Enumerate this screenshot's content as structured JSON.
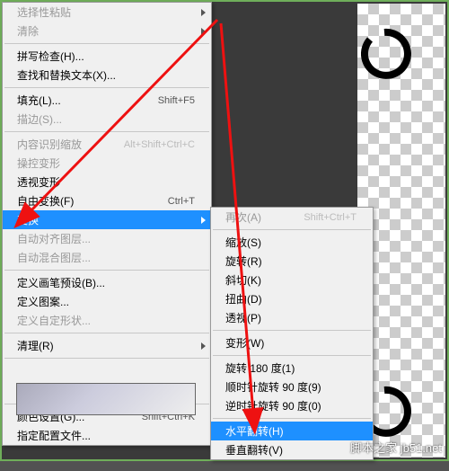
{
  "main_menu": {
    "groups": [
      [
        {
          "label": "选择性粘贴",
          "shortcut": "",
          "disabled": true,
          "arrow": true
        },
        {
          "label": "清除",
          "shortcut": "",
          "disabled": true,
          "arrow": true
        }
      ],
      [
        {
          "label": "拼写检查(H)...",
          "shortcut": ""
        },
        {
          "label": "查找和替换文本(X)...",
          "shortcut": ""
        }
      ],
      [
        {
          "label": "填充(L)...",
          "shortcut": "Shift+F5"
        },
        {
          "label": "描边(S)...",
          "shortcut": "",
          "disabled": true
        }
      ],
      [
        {
          "label": "内容识别缩放",
          "shortcut": "Alt+Shift+Ctrl+C",
          "disabled": true
        },
        {
          "label": "操控变形",
          "shortcut": "",
          "disabled": true
        },
        {
          "label": "透视变形",
          "shortcut": ""
        },
        {
          "label": "自由变换(F)",
          "shortcut": "Ctrl+T"
        },
        {
          "label": "变换",
          "shortcut": "",
          "highlight": true,
          "arrow": true
        },
        {
          "label": "自动对齐图层...",
          "shortcut": "",
          "disabled": true
        },
        {
          "label": "自动混合图层...",
          "shortcut": "",
          "disabled": true
        }
      ],
      [
        {
          "label": "定义画笔预设(B)...",
          "shortcut": ""
        },
        {
          "label": "定义图案...",
          "shortcut": ""
        },
        {
          "label": "定义自定形状...",
          "shortcut": "",
          "disabled": true
        }
      ],
      [
        {
          "label": "清理(R)",
          "shortcut": "",
          "arrow": true
        }
      ]
    ],
    "bottom": [
      {
        "label": "颜色设置(G)...",
        "shortcut": "Shift+Ctrl+K"
      },
      {
        "label": "指定配置文件...",
        "shortcut": ""
      }
    ]
  },
  "sub_menu": {
    "groups": [
      [
        {
          "label": "再次(A)",
          "shortcut": "Shift+Ctrl+T",
          "disabled": true
        }
      ],
      [
        {
          "label": "缩放(S)",
          "shortcut": ""
        },
        {
          "label": "旋转(R)",
          "shortcut": ""
        },
        {
          "label": "斜切(K)",
          "shortcut": ""
        },
        {
          "label": "扭曲(D)",
          "shortcut": ""
        },
        {
          "label": "透视(P)",
          "shortcut": ""
        }
      ],
      [
        {
          "label": "变形(W)",
          "shortcut": ""
        }
      ],
      [
        {
          "label": "旋转 180 度(1)",
          "shortcut": ""
        },
        {
          "label": "顺时针旋转 90 度(9)",
          "shortcut": ""
        },
        {
          "label": "逆时针旋转 90 度(0)",
          "shortcut": ""
        }
      ],
      [
        {
          "label": "水平翻转(H)",
          "shortcut": "",
          "highlight": true
        },
        {
          "label": "垂直翻转(V)",
          "shortcut": ""
        }
      ]
    ]
  },
  "watermark": "脚本之家 jb51.net"
}
